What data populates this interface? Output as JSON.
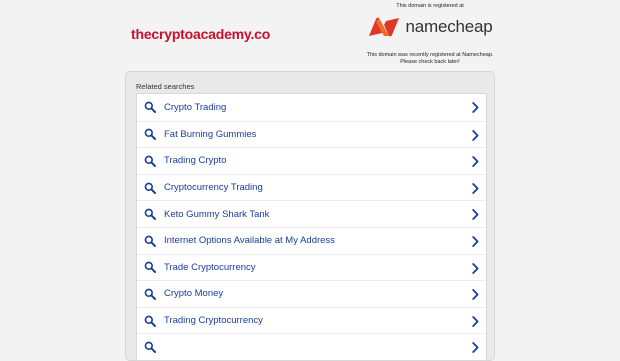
{
  "header": {
    "domain": "thecryptoacademy.co",
    "registered_at_text": "This domain is registered at",
    "registrar_name": "namecheap",
    "note_line1": "This domain was recently registered at Namecheap.",
    "note_line2": "Please check back later!"
  },
  "related": {
    "title": "Related searches",
    "items": [
      {
        "label": "Crypto Trading"
      },
      {
        "label": "Fat Burning Gummies"
      },
      {
        "label": "Trading Crypto"
      },
      {
        "label": "Cryptocurrency Trading"
      },
      {
        "label": "Keto Gummy Shark Tank"
      },
      {
        "label": "Internet Options Available at My Address"
      },
      {
        "label": "Trade Cryptocurrency"
      },
      {
        "label": "Crypto Money"
      },
      {
        "label": "Trading Cryptocurrency"
      },
      {
        "label": ""
      }
    ]
  },
  "colors": {
    "domain": "#c8102e",
    "link": "#1a3d9e",
    "logo_orange": "#de3723"
  },
  "icons": {
    "search": "search-icon",
    "chevron": "chevron-right-icon",
    "logo": "namecheap-logo"
  }
}
